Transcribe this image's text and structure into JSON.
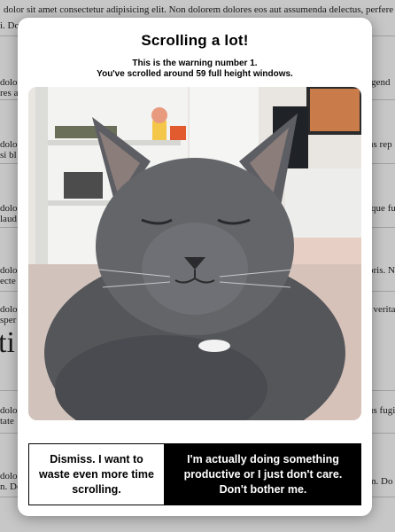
{
  "background": {
    "top_line": "dolor sit amet consectetur adipisicing elit. Non dolorem dolores eos aut assumenda delectus, perferendis aliqua",
    "top_line2": "i. Do",
    "heading_fragment": "ti",
    "left_fragments": [
      "dolo",
      "res a",
      "dolo",
      "si bl",
      "dolo",
      "laud",
      "dolo",
      "ecte",
      "dolo",
      "sper",
      "dolo",
      "tate",
      "dolo",
      "n. Do"
    ],
    "right_fragments": [
      "igend",
      "us rep",
      "tque fu",
      "oris. N",
      ", verita",
      "us fugi",
      "m. Do"
    ]
  },
  "modal": {
    "title": "Scrolling a lot!",
    "message_line1": "This is the warning number 1.",
    "message_line2": "You've scrolled around 59 full height windows.",
    "dismiss_label": "Dismiss. I want to waste even more time scrolling.",
    "productive_label": "I'm actually doing something productive or I just don't care. Don't bother me."
  }
}
